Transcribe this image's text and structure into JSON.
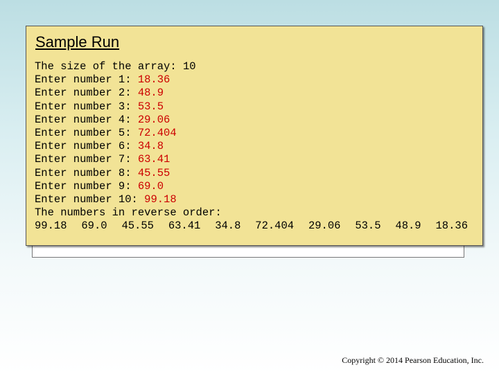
{
  "slide": {
    "title": "Sample Run",
    "background_mark": ";",
    "copyright": "Copyright © 2014 Pearson Education, Inc."
  },
  "console": {
    "size_prompt": "The size of the array: ",
    "size_value": "10",
    "entries": [
      {
        "prompt": "Enter number 1: ",
        "value": "18.36"
      },
      {
        "prompt": "Enter number 2: ",
        "value": "48.9"
      },
      {
        "prompt": "Enter number 3: ",
        "value": "53.5"
      },
      {
        "prompt": "Enter number 4: ",
        "value": "29.06"
      },
      {
        "prompt": "Enter number 5: ",
        "value": "72.404"
      },
      {
        "prompt": "Enter number 6: ",
        "value": "34.8"
      },
      {
        "prompt": "Enter number 7: ",
        "value": "63.41"
      },
      {
        "prompt": "Enter number 8: ",
        "value": "45.55"
      },
      {
        "prompt": "Enter number 9: ",
        "value": "69.0"
      },
      {
        "prompt": "Enter number 10: ",
        "value": "99.18"
      }
    ],
    "reverse_header": "The numbers in reverse order:",
    "reversed": [
      "99.18",
      "69.0",
      "45.55",
      "63.41",
      "34.8",
      "72.404",
      "29.06",
      "53.5",
      "48.9",
      "18.36"
    ]
  },
  "colors": {
    "input_text": "#cc0000",
    "panel_background": "#f2e396"
  }
}
